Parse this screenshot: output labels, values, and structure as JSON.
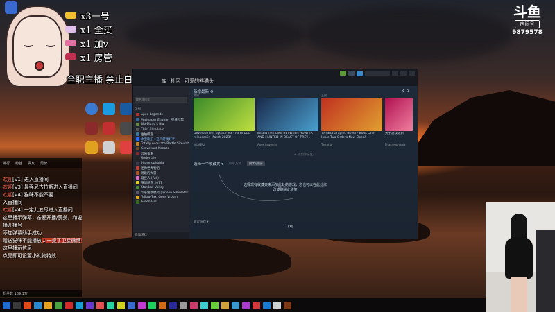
{
  "overlay": {
    "gifts": [
      {
        "label": "x3一号",
        "color": "#f0c030"
      },
      {
        "label": "x1 全买",
        "color": "#e0c0e8"
      },
      {
        "label": "x1 加v",
        "color": "#e070a0"
      },
      {
        "label": "x1 房管",
        "color": "#c03050"
      }
    ],
    "notice": "全职主播 禁止白嫖"
  },
  "douyu": {
    "logo": "斗鱼",
    "room_label": "房间号",
    "room_number": "9879578"
  },
  "steam": {
    "nav": [
      "库",
      "社区",
      "可爱的熊猫头"
    ],
    "user_button": "",
    "sidebar": {
      "search_placeholder": "按名称搜索",
      "section_all": "全部",
      "games": [
        {
          "name": "Apex Legends",
          "color": "#b03030"
        },
        {
          "name": "Wallpaper Engine：壁纸引擎",
          "color": "#2a6aa0"
        },
        {
          "name": "Bio-Mario's Big",
          "color": "#6a8a3a"
        },
        {
          "name": "Thief Simulator",
          "color": "#555"
        },
        {
          "name": "拍拍棋盘",
          "color": "#3a7a9a"
        },
        {
          "name": "水宝欢乐 · 这个游戏好手",
          "color": "#2a6aff"
        },
        {
          "name": "Totally Accurate Battle Simulator",
          "color": "#c08030"
        },
        {
          "name": "Graveyard Keeper",
          "color": "#6a4a2a"
        },
        {
          "name": "恐怖鬼畜",
          "color": "#8a2a2a"
        },
        {
          "name": "Undertale",
          "color": "#222"
        },
        {
          "name": "Phasmophobia",
          "color": "#3a3a4a"
        },
        {
          "name": "迷你世界物语",
          "color": "#c04040"
        },
        {
          "name": "跳跳的大冒",
          "color": "#aa5a2a"
        },
        {
          "name": "糖豆人 (Fall)",
          "color": "#e070c0"
        },
        {
          "name": "赛博朋克 2077",
          "color": "#e0d020"
        },
        {
          "name": "Stardew Valley",
          "color": "#4a8a3a"
        },
        {
          "name": "欢乐警察模拟 | Prison Simulator",
          "color": "#5a5a6a"
        },
        {
          "name": "Yellow Taxi Goes Vroom",
          "color": "#e0b020"
        },
        {
          "name": "Green Hell",
          "color": "#3a6a2a"
        }
      ],
      "footer": "添加游戏"
    },
    "main": {
      "whats_new": "新增最新 ⚙",
      "cards": [
        {
          "date": "本周",
          "title": "Development update #3 - Farm DLC releases in March 2023!",
          "game": "农场模拟",
          "art": "#3a8a2a"
        },
        {
          "date": "",
          "title": "BEGIN THE LINE BETWEEN HUNTER AND HUNTED IN BEAST OF PREY...",
          "game": "Apex Legends",
          "art": "#1a2a4a"
        },
        {
          "date": "上周",
          "title": "Terraria Graphic Novel - Book One, Issue Two Orders Now Open!",
          "game": "Terraria",
          "art": "#c03020"
        },
        {
          "date": "",
          "title": "关于游戏更新",
          "game": "Phasmophobia",
          "art": "#b01050"
        }
      ],
      "add_shelf": "+ 添加库分区",
      "shelf_title": "选择一个收藏夹 ▾",
      "sort_by": "排序方式",
      "sort_value": "按字母顺序",
      "empty_message": "选择现有收藏夹来添加此处的游戏，您也可以在此处修改或删除此货架",
      "recent": "最近游戏 ▾",
      "downloads": "下载"
    }
  },
  "chat": {
    "header": [
      "排行",
      "粉丝",
      "贵宾",
      "周榜"
    ],
    "lines": [
      {
        "user": "欢迎",
        "text": "[V1] 进入直播间",
        "hl": ""
      },
      {
        "user": "欢迎",
        "text": "[V3] 最强尼古拉斯进入直播间",
        "hl": ""
      },
      {
        "user": "欢迎",
        "text": "[V4] 猫咪不能不要",
        "hl": ""
      },
      {
        "user": "",
        "text": "入直播间",
        "hl": ""
      },
      {
        "user": "欢迎",
        "text": "[V4] 一定九五尽进入直播间",
        "hl": ""
      },
      {
        "user": "",
        "text": "这里播示弹幕，亲爱开播/赞美，和说",
        "hl": ""
      },
      {
        "user": "",
        "text": "播开播号",
        "hl": ""
      },
      {
        "user": "",
        "text": "添加弹幕助手成功",
        "hl": ""
      },
      {
        "user": "",
        "text": "赠送猫咪不能播放",
        "hl": "1 一桌了卫星微博"
      },
      {
        "user": "",
        "text": "这里播示信息",
        "hl": ""
      },
      {
        "user": "",
        "text": "点亮即可设置小礼物特效",
        "hl": ""
      }
    ],
    "footer": "粉丝数 189.1万"
  },
  "taskbar_icons": [
    "#1e6ad0",
    "#3a3a3a",
    "#e04a1a",
    "#2a8ad0",
    "#e8a020",
    "#4aa040",
    "#d02a2a",
    "#1a9ad0",
    "#6a3ad0",
    "#e05050",
    "#2ad0a0",
    "#d0d020",
    "#3a6ad0",
    "#c03ad0",
    "#1ad060",
    "#d06a1a",
    "#2a2a9a",
    "#9a9a9a",
    "#d03a6a",
    "#3ad0d0",
    "#6ad03a",
    "#d0a03a",
    "#3a9ad0",
    "#ad3ad0",
    "#d03a3a",
    "#1a7ad0",
    "#d0d0d0",
    "#7a3a1a"
  ]
}
